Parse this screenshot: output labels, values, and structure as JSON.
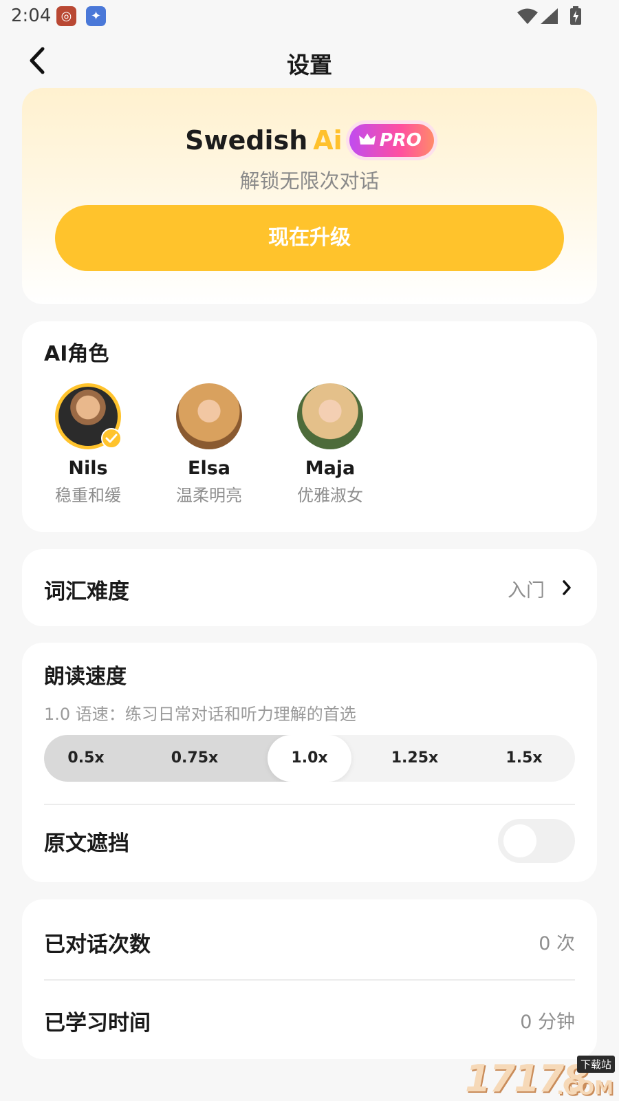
{
  "status_bar": {
    "time": "2:04",
    "icons": [
      "weibo-app-icon",
      "qq-browser-app-icon",
      "wifi-icon",
      "signal-icon",
      "battery-charging-icon"
    ]
  },
  "header": {
    "title": "设置",
    "back_icon": "chevron-left-icon"
  },
  "promo": {
    "app_name": "Swedish",
    "ai": "Ai",
    "badge": "PRO",
    "subtitle": "解锁无限次对话",
    "upgrade_label": "现在升级",
    "accent_color": "#ffc32c"
  },
  "roles": {
    "title": "AI角色",
    "items": [
      {
        "name": "Nils",
        "desc": "稳重和缓",
        "selected": true
      },
      {
        "name": "Elsa",
        "desc": "温柔明亮",
        "selected": false
      },
      {
        "name": "Maja",
        "desc": "优雅淑女",
        "selected": false
      }
    ]
  },
  "vocab": {
    "label": "词汇难度",
    "value": "入门"
  },
  "speed": {
    "title": "朗读速度",
    "desc": "1.0 语速：练习日常对话和听力理解的首选",
    "options": [
      "0.5x",
      "0.75x",
      "1.0x",
      "1.25x",
      "1.5x"
    ],
    "selected": "1.0x"
  },
  "mask": {
    "label": "原文遮挡",
    "enabled": false
  },
  "stats": {
    "conversations_label": "已对话次数",
    "conversations_value": "0 次",
    "study_time_label": "已学习时间",
    "study_time_value": "0 分钟"
  },
  "watermark": {
    "digits": "17178",
    "tag": "下载站",
    "suffix": ".COM"
  }
}
